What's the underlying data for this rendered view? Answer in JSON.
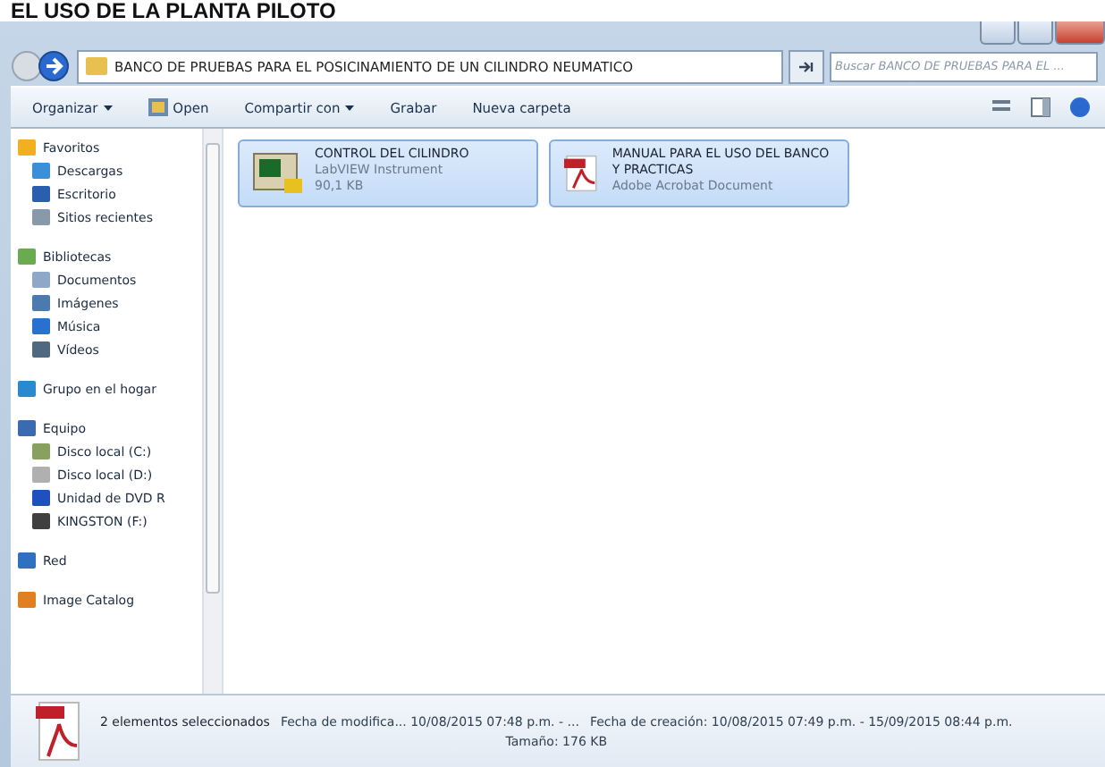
{
  "document_heading": "EL USO DE LA PLANTA PILOTO",
  "address_bar": {
    "path": "BANCO DE PRUEBAS PARA EL POSICINAMIENTO DE UN CILINDRO NEUMATICO"
  },
  "search": {
    "placeholder": "Buscar BANCO DE PRUEBAS PARA EL ..."
  },
  "toolbar": [
    {
      "label": "Organizar",
      "dropdown": true,
      "kind": "text"
    },
    {
      "label": "Open",
      "dropdown": false,
      "kind": "icon"
    },
    {
      "label": "Compartir con",
      "dropdown": true,
      "kind": "text"
    },
    {
      "label": "Grabar",
      "dropdown": false,
      "kind": "text"
    },
    {
      "label": "Nueva carpeta",
      "dropdown": false,
      "kind": "text"
    }
  ],
  "sidebar": {
    "items": [
      {
        "label": "Favoritos",
        "kind": "star",
        "children": [
          {
            "label": "Descargas",
            "kind": "download"
          },
          {
            "label": "Escritorio",
            "kind": "desktop"
          },
          {
            "label": "Sitios recientes",
            "kind": "recent"
          }
        ]
      },
      {
        "label": "Bibliotecas",
        "kind": "library",
        "children": [
          {
            "label": "Documentos",
            "kind": "docs"
          },
          {
            "label": "Imágenes",
            "kind": "images"
          },
          {
            "label": "Música",
            "kind": "music"
          },
          {
            "label": "Vídeos",
            "kind": "video"
          }
        ]
      },
      {
        "label": "Grupo en el hogar",
        "kind": "homegroup"
      },
      {
        "label": "Equipo",
        "kind": "computer",
        "children": [
          {
            "label": "Disco local (C:)",
            "kind": "disk"
          },
          {
            "label": "Disco local (D:)",
            "kind": "disk2"
          },
          {
            "label": "Unidad de DVD R",
            "kind": "dvd"
          },
          {
            "label": "KINGSTON (F:)",
            "kind": "usb"
          }
        ]
      },
      {
        "label": "Red",
        "kind": "network"
      },
      {
        "label": "Image Catalog",
        "kind": "catalog"
      }
    ]
  },
  "files": [
    {
      "name": "CONTROL DEL CILINDRO",
      "type": "LabVIEW Instrument",
      "size": "90,1 KB",
      "kind": "labview",
      "selected": true
    },
    {
      "name": "MANUAL PARA EL USO DEL BANCO Y PRACTICAS",
      "type": "Adobe Acrobat Document",
      "kind": "pdf",
      "selected": true
    }
  ],
  "details": {
    "summary": "2 elementos seleccionados",
    "modified": "Fecha de modifica... 10/08/2015 07:48 p.m. - ...",
    "created": "Fecha de creación: 10/08/2015 07:49 p.m. - 15/09/2015 08:44 p.m.",
    "size": "Tamaño: 176 KB"
  }
}
